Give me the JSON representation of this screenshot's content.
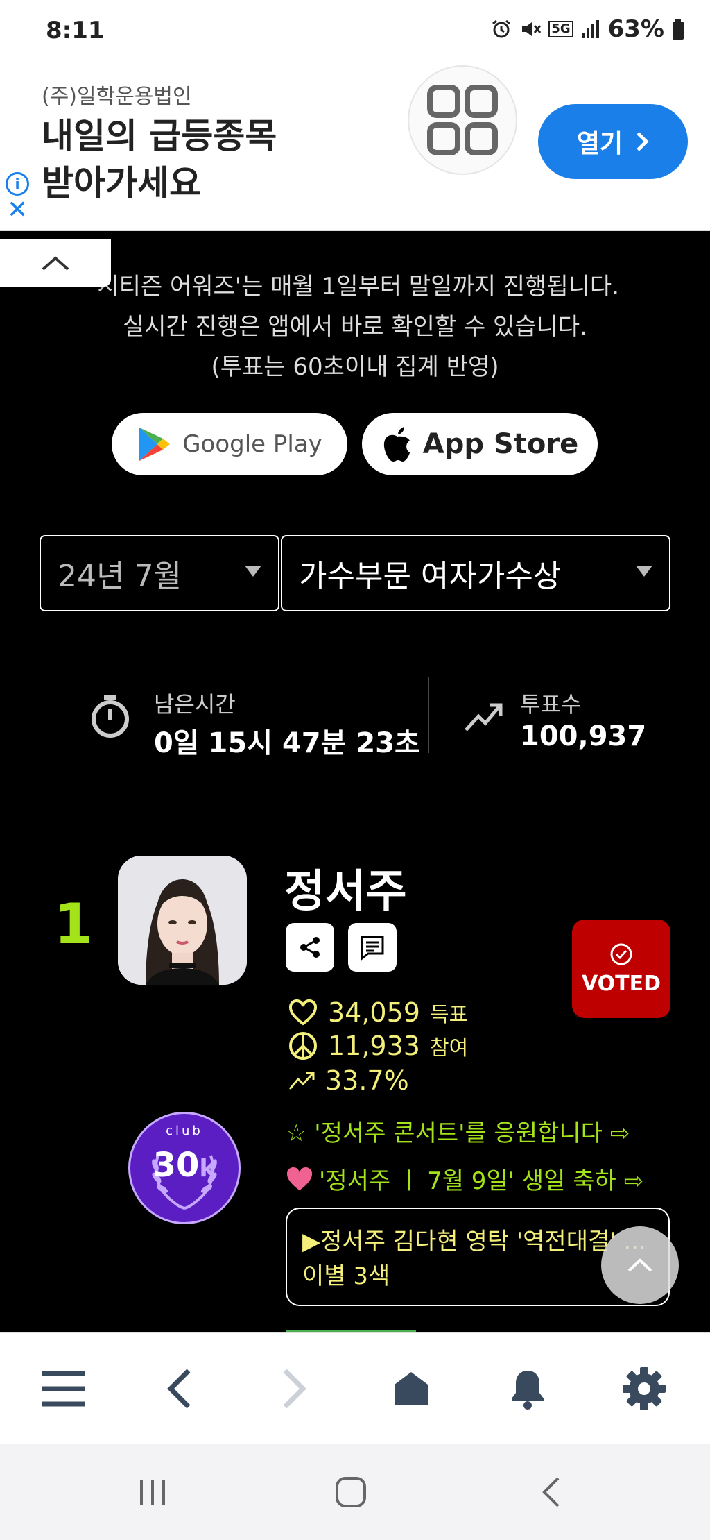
{
  "status_bar": {
    "time": "8:11",
    "battery": "63%",
    "network": "5G"
  },
  "ad": {
    "corp": "(주)일학운용법인",
    "headline_1": "내일의 급등종목",
    "headline_2": "받아가세요",
    "open_label": "열기"
  },
  "notice": {
    "line1": "'시티즌 어워즈'는 매월 1일부터 말일까지 진행됩니다.",
    "line2": "실시간 진행은 앱에서 바로 확인할 수 있습니다.",
    "line3": "(투표는 60초이내 집계 반영)"
  },
  "stores": {
    "google_play": "Google Play",
    "app_store": "App Store"
  },
  "filters": {
    "month": "24년 7월",
    "category": "가수부문 여자가수상"
  },
  "stats": {
    "remaining_label": "남은시간",
    "remaining_value": "0일 15시 47분 23초",
    "votes_label": "투표수",
    "votes_value": "100,937"
  },
  "entry": {
    "rank": "1",
    "name": "정서주",
    "voted_label": "VOTED",
    "votes": "34,059",
    "votes_unit": "득표",
    "participants": "11,933",
    "participants_unit": "참여",
    "share": "33.7%",
    "club_label": "club",
    "club_value": "30",
    "club_unit": "k",
    "promo_concert": "☆ '정서주 콘서트'를 응원합니다 ⇨",
    "promo_birthday": "'정서주 ㅣ 7월 9일' 생일 축하 ⇨",
    "news_line1": "▶정서주 김다현 영탁 '역전대결' ...",
    "news_line2": "이별 3색"
  },
  "colors": {
    "accent_green": "#a4e31a",
    "voted_red": "#bf0000",
    "metric_yellow": "#f3ef7a",
    "ad_blue": "#1a7fe8"
  }
}
